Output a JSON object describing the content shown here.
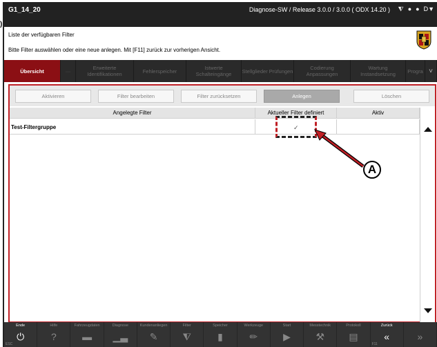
{
  "titlebar": {
    "title": "G1_14_20",
    "version": "Diagnose-SW / Release 3.0.0 / 3.0.0  ( ODX  14.20 )",
    "status_icons": [
      "⧨",
      "●",
      "●",
      "D▼"
    ]
  },
  "left_stub": ")",
  "header": {
    "line1": "Liste der verfügbaren Filter",
    "line2": "Bitte Filter auswählen oder eine neue anlegen. Mit [F11] zurück zur vorherigen Ansicht."
  },
  "tabs": [
    {
      "label": "Übersicht",
      "active": true
    },
    {
      "label": "···",
      "active": false
    },
    {
      "label": "Erweiterte Identifikationen",
      "active": false
    },
    {
      "label": "Fehlerspeicher",
      "active": false
    },
    {
      "label": "Istwerte Schalteingänge",
      "active": false
    },
    {
      "label": "Stellglieder Prüfungen",
      "active": false
    },
    {
      "label": "Codierung Anpassungen",
      "active": false
    },
    {
      "label": "Wartung Instandsetzung",
      "active": false
    },
    {
      "label": "Progra",
      "active": false
    },
    {
      "label": "˅",
      "active": false
    }
  ],
  "actions": {
    "aktivieren": "Aktivieren",
    "bearbeiten": "Filter bearbeiten",
    "zuruecksetzen": "Filter zurücksetzen",
    "anlegen": "Anlegen",
    "loeschen": "Löschen"
  },
  "grid": {
    "headers": [
      "Angelegte Filter",
      "Aktueller Filter definiert",
      "Aktiv"
    ],
    "rows": [
      {
        "name": "Test-Filtergruppe",
        "defined": "✓",
        "active": ""
      }
    ]
  },
  "callout": "A",
  "footer": [
    {
      "label": "Ende",
      "icon": "⏻",
      "code": "ESC",
      "on": true
    },
    {
      "label": "Hilfe",
      "icon": "?",
      "code": "",
      "on": false
    },
    {
      "label": "Fahrzeugdaten",
      "icon": "▬",
      "code": "",
      "on": false
    },
    {
      "label": "Diagnose",
      "icon": "▁▃",
      "code": "",
      "on": false
    },
    {
      "label": "Kundenanliegen",
      "icon": "✎",
      "code": "",
      "on": false
    },
    {
      "label": "Filter",
      "icon": "⧨",
      "code": "",
      "on": false
    },
    {
      "label": "Speicher",
      "icon": "▮",
      "code": "",
      "on": false
    },
    {
      "label": "Werkzeuge",
      "icon": "✏",
      "code": "",
      "on": false
    },
    {
      "label": "Start",
      "icon": "▶",
      "code": "",
      "on": false
    },
    {
      "label": "Messtechnik",
      "icon": "⚒",
      "code": "",
      "on": false
    },
    {
      "label": "Protokoll",
      "icon": "▤",
      "code": "",
      "on": false
    },
    {
      "label": "Zurück",
      "icon": "«",
      "code": "F11",
      "on": true
    },
    {
      "label": "",
      "icon": "»",
      "code": "",
      "on": false
    }
  ],
  "colors": {
    "accent_red": "#8b0f14",
    "panel_border": "#c01f25",
    "titlebar": "#222222",
    "footer": "#333333"
  }
}
